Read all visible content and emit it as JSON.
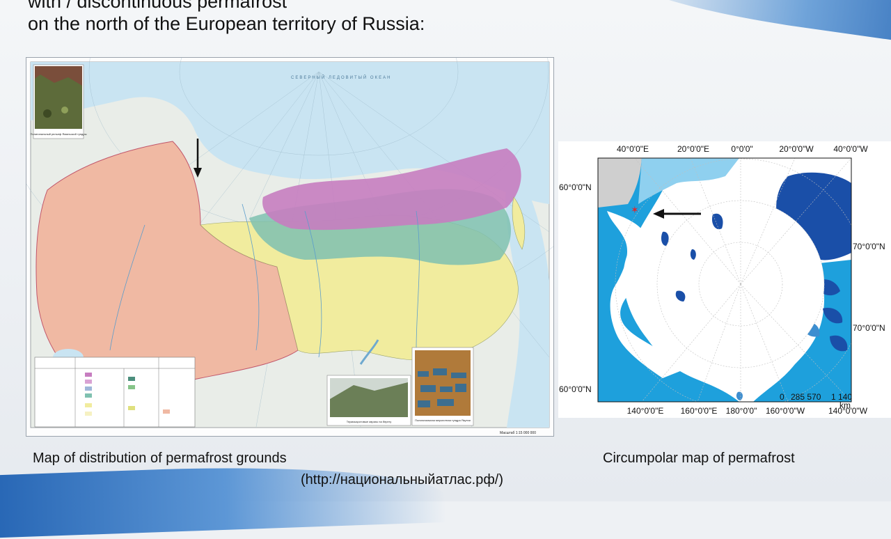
{
  "slide": {
    "title_line1": "with / discontinuous permafrost",
    "title_line2": "on the north of the European territory of Russia:"
  },
  "captions": {
    "left": "Map of distribution of permafrost grounds",
    "url": "(http://национальныйатлас.рф/)",
    "right": "Circumpolar map of permafrost"
  },
  "russia_map": {
    "scale_text": "Масштаб 1:15 000 000",
    "inset_top_caption": "Полигональный рельеф Ямальской тундры",
    "inset_bottom1_caption": "Термокарстовые оврагы на берегу",
    "inset_bottom2_caption": "Полигональная мерзлотная тундра Якутии",
    "sea_label": "СЕВЕРНЫЙ ЛЕДОВИТЫЙ ОКЕАН"
  },
  "circumpolar_map": {
    "top_coords": [
      "40°0'0\"E",
      "20°0'0\"E",
      "0°0'0\"",
      "20°0'0\"W",
      "40°0'0\"W"
    ],
    "bottom_coords": [
      "140°0'0\"E",
      "160°0'0\"E",
      "180°0'0\"",
      "160°0'0\"W",
      "140°0'0\"W"
    ],
    "left_coords": [
      "60°0'0\"N",
      "60°0'0\"N"
    ],
    "right_coords": [
      "70°0'0\"N",
      "70°0'0\"N"
    ],
    "scale_values": [
      "0",
      "285 570",
      "1 140"
    ],
    "scale_unit": "km"
  },
  "colors": {
    "ocean": "#c9e4f2",
    "russia_pink": "#f0b9a3",
    "permafrost_purple": "#c77dc0",
    "permafrost_teal": "#7fc1b0",
    "permafrost_yellow": "#f1ec9e",
    "circ_sea": "#1ea0dc",
    "circ_ice": "#1a4fa8"
  }
}
